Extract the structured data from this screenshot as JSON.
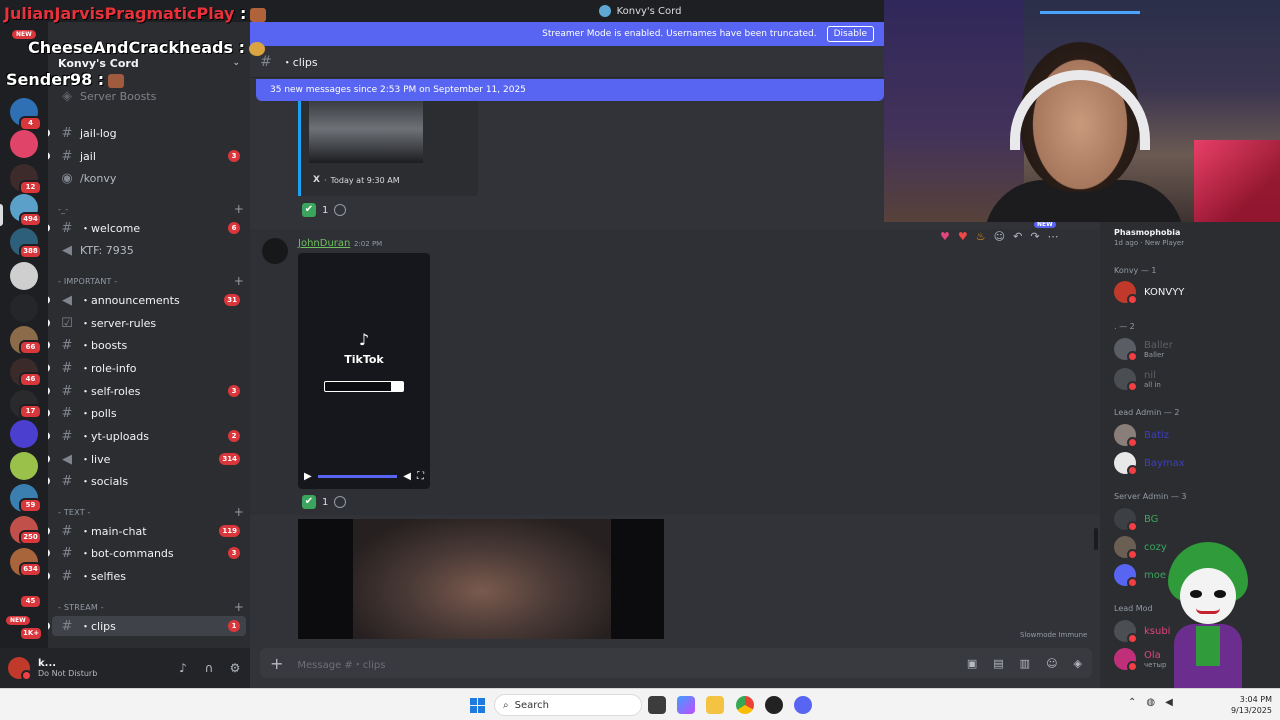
{
  "window": {
    "title": "Konvy's Cord"
  },
  "streamer_mode": {
    "text": "Streamer Mode is enabled. Usernames have been truncated.",
    "button": "Disable"
  },
  "overlay_chat": [
    {
      "user": "JulianJarvisPragmaticPlay",
      "suffix": " :"
    },
    {
      "user": "CheeseAndCrackheads",
      "suffix": " :"
    },
    {
      "user": "Sender98",
      "suffix": " :"
    }
  ],
  "overlay_new": "NEW",
  "server_rail": {
    "badges": [
      "4",
      "12",
      "494",
      "388",
      "66",
      "46",
      "17",
      "59",
      "250",
      "634",
      "45",
      "1K+"
    ],
    "new_label": "NEW"
  },
  "server": {
    "name": "Konvy's Cord",
    "boosts": "Server Boosts"
  },
  "channels_top": [
    {
      "name": "jail-log",
      "badge": ""
    },
    {
      "name": "jail",
      "badge": "3"
    }
  ],
  "stage": {
    "name": "/konvy"
  },
  "cat_misc": "-_-",
  "misc_channels": [
    {
      "name": "・welcome",
      "badge": "6"
    }
  ],
  "voice_ktf": "KTF: 7935",
  "categories": {
    "important": "- IMPORTANT -",
    "text": "- TEXT -",
    "stream": "- STREAM -"
  },
  "important_channels": [
    {
      "name": "・announcements",
      "badge": "31"
    },
    {
      "name": "・server-rules",
      "badge": ""
    },
    {
      "name": "・boosts",
      "badge": ""
    },
    {
      "name": "・role-info",
      "badge": ""
    },
    {
      "name": "・self-roles",
      "badge": "3"
    },
    {
      "name": "・polls",
      "badge": ""
    },
    {
      "name": "・yt-uploads",
      "badge": "2"
    },
    {
      "name": "・live",
      "badge": "314"
    },
    {
      "name": "・socials",
      "badge": ""
    }
  ],
  "text_channels": [
    {
      "name": "・main-chat",
      "badge": "119"
    },
    {
      "name": "・bot-commands",
      "badge": "3"
    },
    {
      "name": "・selfies",
      "badge": ""
    }
  ],
  "stream_channels": [
    {
      "name": "・clips",
      "badge": "1"
    }
  ],
  "user_panel": {
    "name": "k...",
    "status": "Do Not Disturb"
  },
  "channel_header": {
    "name": "・clips"
  },
  "new_messages_bar": "35 new messages since 2:53 PM on September 11, 2025",
  "embed": {
    "source": "X",
    "time": "Today at 9:30 AM"
  },
  "reactions": [
    {
      "emoji": "✔",
      "count": "1"
    },
    {
      "emoji": "✔",
      "count": "1"
    }
  ],
  "message": {
    "author": "JohnDuran",
    "time": "2:02 PM",
    "video_title": "TikTok"
  },
  "hover_actions": {
    "new": "NEW"
  },
  "slowmode": "Slowmode Immune",
  "composer": {
    "placeholder": "Message #・clips"
  },
  "members": {
    "activity_game": "Phasmophobia",
    "activity_sub": "1d ago · New Player",
    "groups": [
      {
        "title": "Konvy — 1",
        "members": [
          {
            "name": "KONVYY",
            "status": "",
            "color": "#f2f3f5"
          }
        ]
      },
      {
        "title": ". — 2",
        "members": [
          {
            "name": "Baller",
            "status": "Baller",
            "color": "#5c5f66"
          },
          {
            "name": "nil",
            "status": "all in",
            "color": "#5c5f66"
          }
        ]
      },
      {
        "title": "Lead Admin — 2",
        "members": [
          {
            "name": "Batiz",
            "status": "",
            "color": "#3b3fc4"
          },
          {
            "name": "Baymax",
            "status": "",
            "color": "#3b3fc4"
          }
        ]
      },
      {
        "title": "Server Admin — 3",
        "members": [
          {
            "name": "BG",
            "status": "",
            "color": "#3ba55d"
          },
          {
            "name": "cozy",
            "status": "",
            "color": "#3ba55d"
          },
          {
            "name": "moe",
            "status": "",
            "color": "#3ba55d"
          }
        ]
      },
      {
        "title": "Lead Mod",
        "members": [
          {
            "name": "ksubi",
            "status": "",
            "color": "#e0457b"
          },
          {
            "name": "Ola",
            "status": "четыр",
            "color": "#e0457b"
          }
        ]
      }
    ]
  },
  "taskbar": {
    "search": "Search",
    "time": "3:04 PM",
    "date": "9/13/2025"
  },
  "colors": {
    "blurple": "#5865f2",
    "badge_red": "#da373c",
    "online_green": "#3ba55d"
  }
}
